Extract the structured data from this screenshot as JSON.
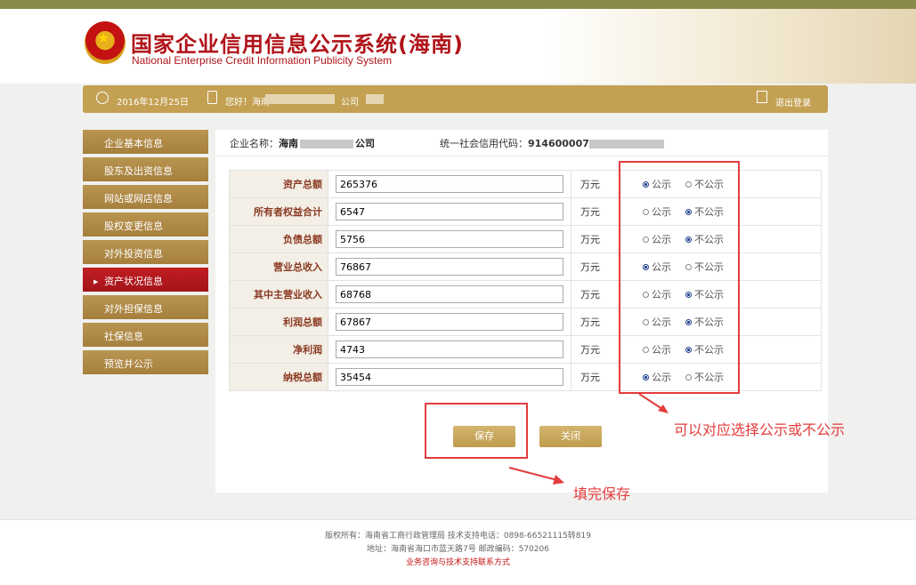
{
  "header": {
    "title_cn": "国家企业信用信息公示系统(海南)",
    "title_en": "National Enterprise Credit Information Publicity System"
  },
  "infobar": {
    "date": "2016年12月25日",
    "greeting": "您好！海南",
    "greeting_suffix": "公司",
    "logout": "退出登录"
  },
  "sidebar": {
    "items": [
      {
        "label": "企业基本信息",
        "active": false
      },
      {
        "label": "股东及出资信息",
        "active": false
      },
      {
        "label": "网站或网店信息",
        "active": false
      },
      {
        "label": "股权变更信息",
        "active": false
      },
      {
        "label": "对外投资信息",
        "active": false
      },
      {
        "label": "资产状况信息",
        "active": true
      },
      {
        "label": "对外担保信息",
        "active": false
      },
      {
        "label": "社保信息",
        "active": false
      },
      {
        "label": "预览并公示",
        "active": false
      }
    ]
  },
  "company": {
    "name_label": "企业名称：",
    "name_prefix": "海南",
    "name_suffix": "公司",
    "credit_label": "统一社会信用代码：",
    "credit_prefix": "914600007"
  },
  "form": {
    "unit": "万元",
    "public_label": "公示",
    "private_label": "不公示",
    "rows": [
      {
        "label": "资产总额",
        "value": "265376",
        "public": true
      },
      {
        "label": "所有者权益合计",
        "value": "6547",
        "public": false
      },
      {
        "label": "负债总额",
        "value": "5756",
        "public": false
      },
      {
        "label": "营业总收入",
        "value": "76867",
        "public": true
      },
      {
        "label": "其中主营业收入",
        "value": "68768",
        "public": false
      },
      {
        "label": "利润总额",
        "value": "67867",
        "public": false
      },
      {
        "label": "净利润",
        "value": "4743",
        "public": false
      },
      {
        "label": "纳税总额",
        "value": "35454",
        "public": true
      }
    ]
  },
  "buttons": {
    "save": "保存",
    "close": "关闭"
  },
  "annotations": {
    "radio_note": "可以对应选择公示或不公示",
    "save_note": "填完保存",
    "color": "#e43c3c"
  },
  "footer": {
    "line1": "版权所有：海南省工商行政管理局 技术支持电话：0898-66521115转819",
    "line2": "地址：海南省海口市蓝天路7号 邮政编码：570206",
    "line3": "业务咨询与技术支持联系方式"
  }
}
